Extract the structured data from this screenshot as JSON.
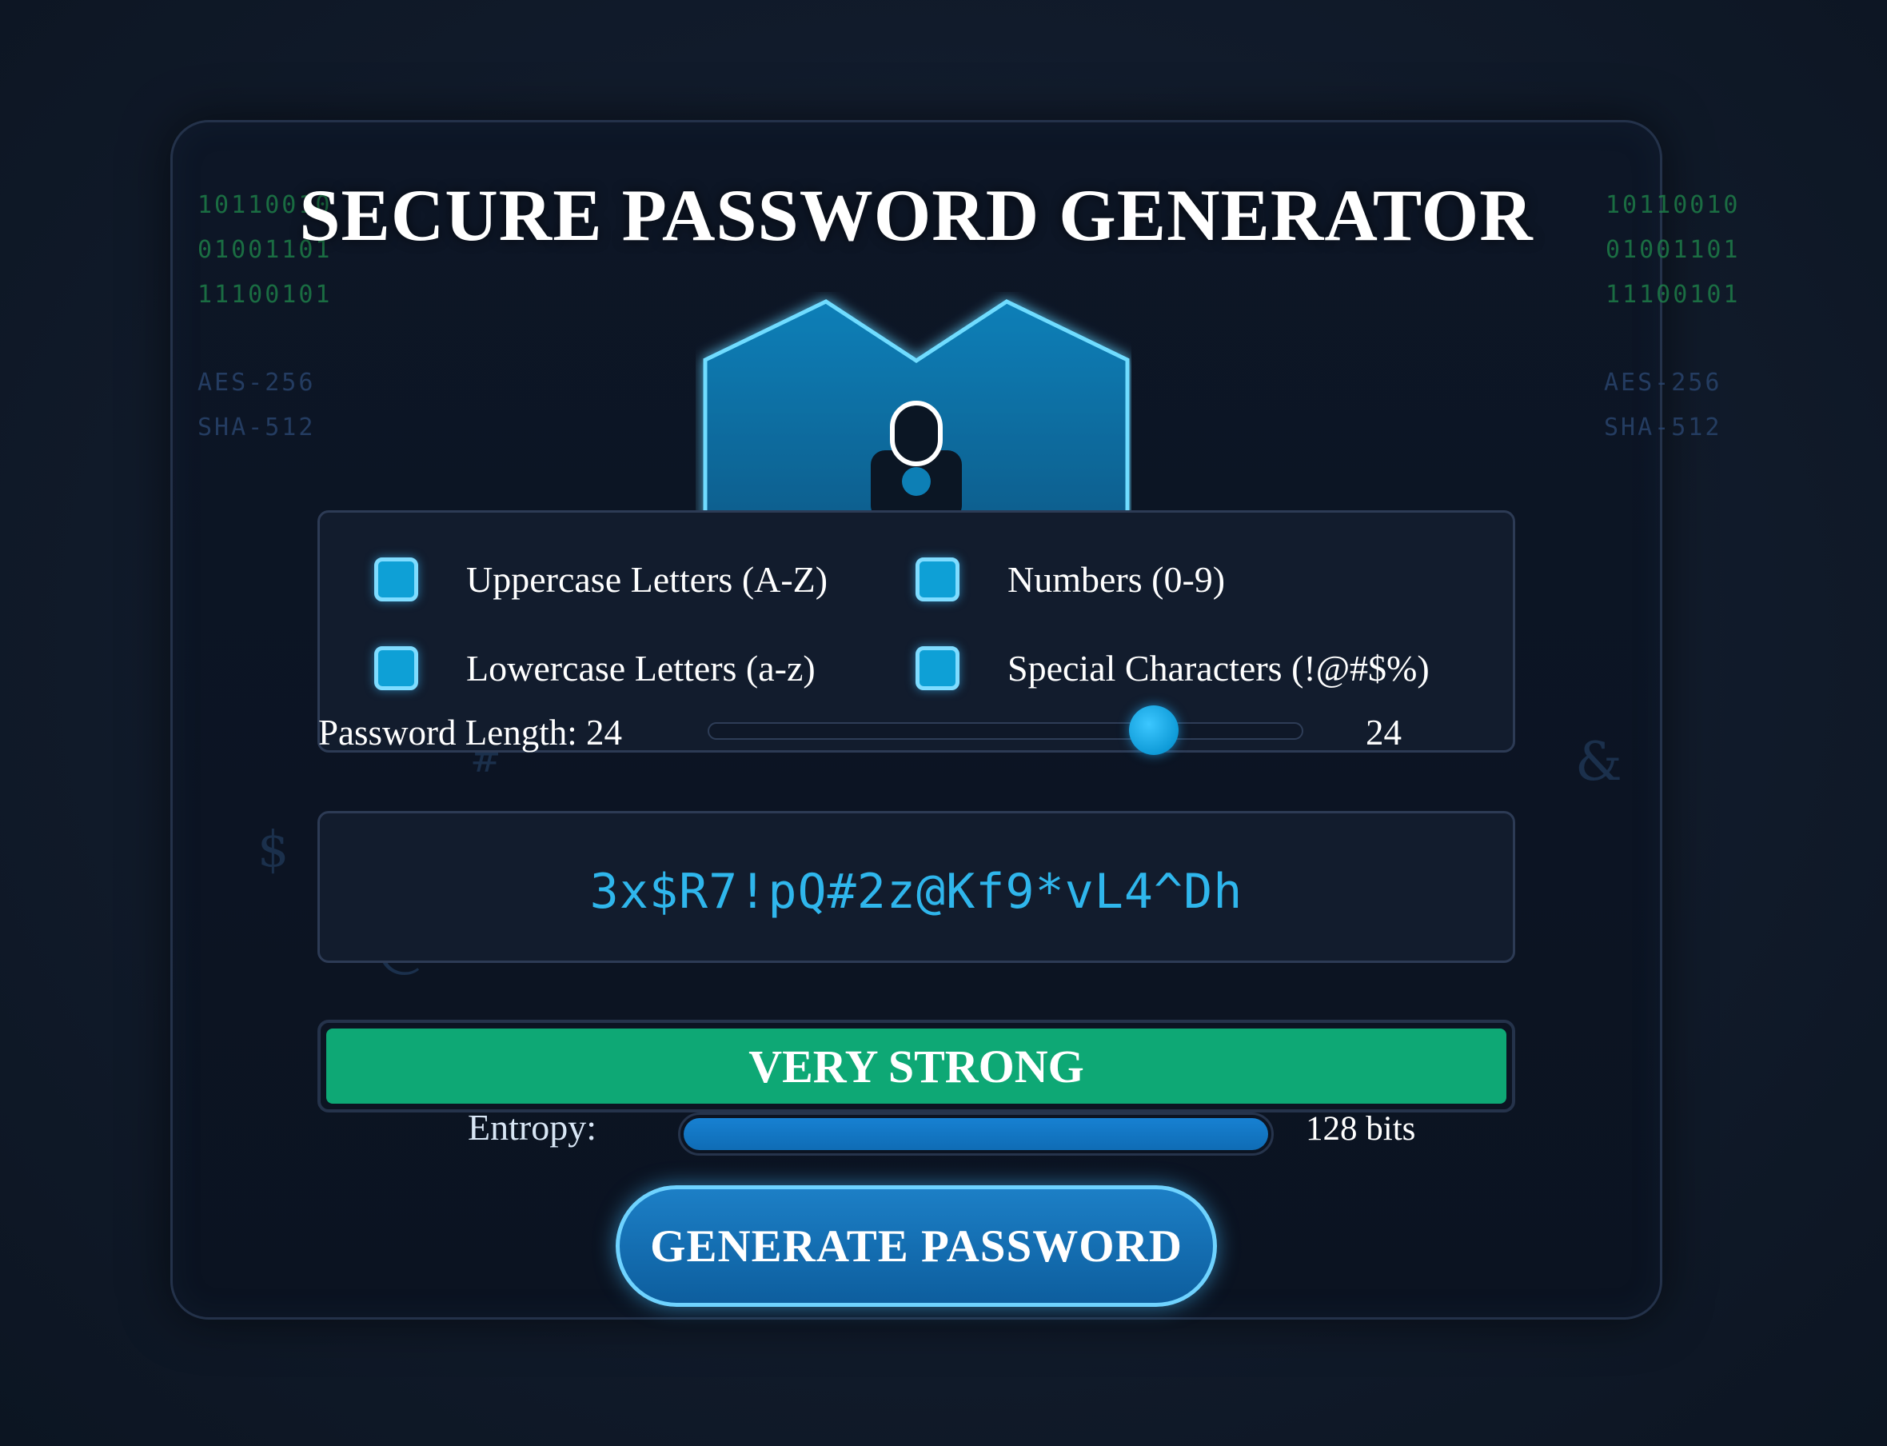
{
  "title": "SECURE PASSWORD GENERATOR",
  "decor": {
    "binary_left": "10110010\n01001101\n11100101",
    "binary_right": "10110010\n01001101\n11100101",
    "algorithms_left": "AES-256\nSHA-512",
    "algorithms_right": "AES-256\nSHA-512",
    "symbols": [
      "#",
      "$",
      "@",
      "%",
      "&",
      "^"
    ]
  },
  "shield_icon": "shield-lock-icon",
  "options": [
    {
      "label": "Uppercase Letters (A-Z)",
      "checked": true
    },
    {
      "label": "Numbers (0-9)",
      "checked": true
    },
    {
      "label": "Lowercase Letters (a-z)",
      "checked": true
    },
    {
      "label": "Special Characters (!@#$%)",
      "checked": true
    }
  ],
  "length": {
    "label": "Password Length: 24",
    "value": "24",
    "slider_fraction": 0.75
  },
  "password": "3x$R7!pQ#2z@Kf9*vL4^Dh",
  "strength": {
    "label": "VERY STRONG",
    "fraction": 1.0
  },
  "entropy": {
    "label": "Entropy:",
    "value": "128 bits",
    "fraction": 1.0
  },
  "generate_button": "GENERATE PASSWORD",
  "colors": {
    "accent": "#0ea0d6",
    "strength_green": "#0ea875",
    "password_text": "#2fb6ec",
    "background": "#111b2b"
  }
}
